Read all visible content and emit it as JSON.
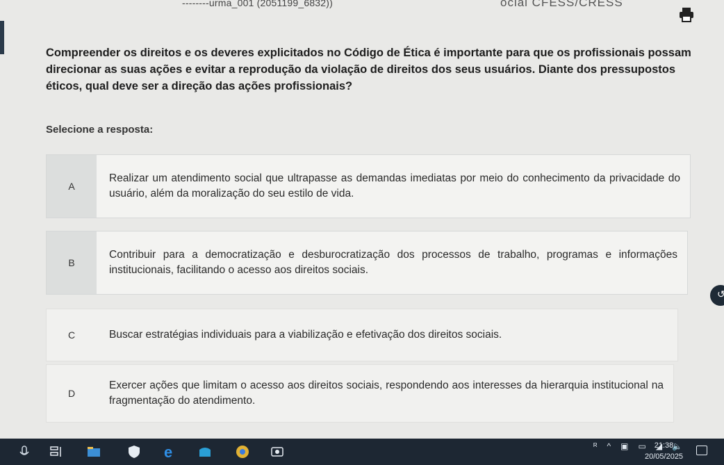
{
  "header": {
    "course_title": "‑‑‑‑‑‑‑‑urma_001 (2051199_6832))",
    "course_code": "ocial CFESS/CRESS"
  },
  "question": {
    "text": "Compreender os direitos e os deveres explicitados no Código de Ética é importante para que os profissionais possam direcionar as suas ações e evitar a reprodução da violação de direitos dos seus usuários. Diante dos pressupostos éticos, qual deve ser a direção das ações profissionais?",
    "select_label": "Selecione a resposta:"
  },
  "options": [
    {
      "letter": "A",
      "text": "Realizar um atendimento social que ultrapasse as demandas imediatas por meio do conhecimento da privacidade do usuário, além da moralização do seu estilo de vida."
    },
    {
      "letter": "B",
      "text": "Contribuir para a democratização e desburocratização dos processos de trabalho, programas e informações institucionais, facilitando o acesso aos direitos sociais."
    },
    {
      "letter": "C",
      "text": "Buscar estratégias individuais para a viabilização e efetivação dos direitos sociais."
    },
    {
      "letter": "D",
      "text": "Exercer ações que limitam o acesso aos direitos sociais, respondendo aos interesses da hierarquia institucional na fragmentação do atendimento."
    }
  ],
  "taskbar": {
    "time": "21:38",
    "date": "20/05/2025"
  },
  "colors": {
    "taskbar": "#1d2733",
    "option_letter_bg": "#dcdedd",
    "page_bg": "#e9e9e7"
  }
}
